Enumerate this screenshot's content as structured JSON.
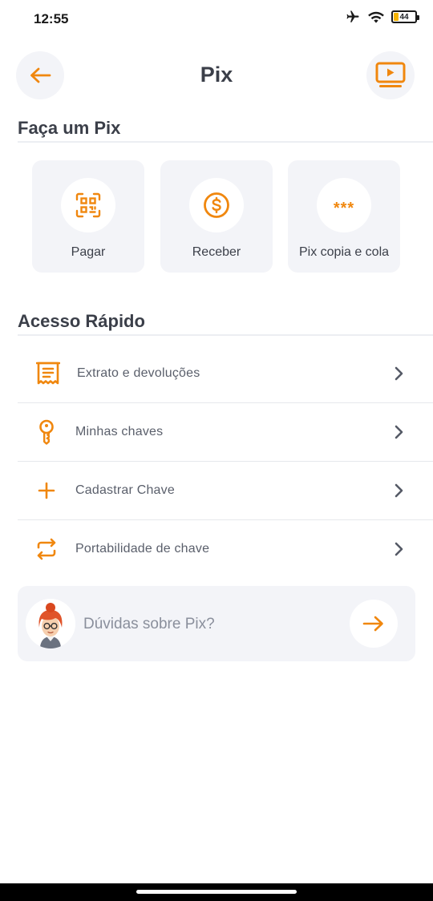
{
  "status_bar": {
    "time": "12:55",
    "battery_level": "44",
    "icons": [
      "airplane-icon",
      "wifi-icon",
      "battery-icon"
    ]
  },
  "header": {
    "title": "Pix",
    "back_icon": "arrow-left-icon",
    "video_icon": "video-play-icon"
  },
  "faca_pix": {
    "title": "Faça um Pix",
    "actions": [
      {
        "label": "Pagar",
        "icon": "qr-code-icon"
      },
      {
        "label": "Receber",
        "icon": "dollar-coin-icon"
      },
      {
        "label": "Pix copia e cola",
        "icon": "asterisks-icon",
        "glyph": "***"
      }
    ]
  },
  "acesso_rapido": {
    "title": "Acesso Rápido",
    "items": [
      {
        "label": "Extrato e devoluções",
        "icon": "receipt-icon"
      },
      {
        "label": "Minhas chaves",
        "icon": "key-icon"
      },
      {
        "label": "Cadastrar Chave",
        "icon": "plus-icon"
      },
      {
        "label": "Portabilidade de chave",
        "icon": "swap-arrows-icon"
      }
    ]
  },
  "help": {
    "label": "Dúvidas sobre Pix?",
    "avatar": "assistant-avatar",
    "arrow_icon": "arrow-right-icon"
  },
  "colors": {
    "accent": "#f0870e",
    "card_bg": "#f3f4f8",
    "title_text": "#3b3f49",
    "muted_text": "#8a8f9c"
  }
}
